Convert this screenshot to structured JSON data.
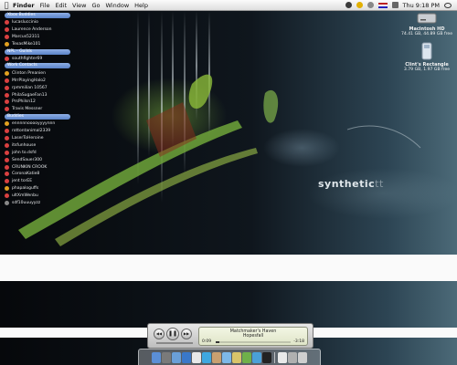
{
  "menubar": {
    "apple": "",
    "items": [
      "Finder",
      "File",
      "Edit",
      "View",
      "Go",
      "Window",
      "Help"
    ],
    "clock": "Thu 9:18 PM"
  },
  "wallpaper": {
    "brand_bold": "synthetic",
    "brand_rest": "tt"
  },
  "desktop_icons": [
    {
      "name": "Macintosh HD",
      "info": "74.41 GB, 44.89 GB free"
    },
    {
      "name": "Clint's Rectangle",
      "info": "3.79 GB, 1.97 GB free"
    }
  ],
  "buddy_list": {
    "groups": [
      {
        "name": "Xbox Buddies",
        "buddies": [
          {
            "name": "lucasluccinio",
            "status": "#d94040"
          },
          {
            "name": "Laurence Anderson",
            "status": "#d94040"
          },
          {
            "name": "Marcus52311",
            "status": "#d94040"
          },
          {
            "name": "TexasMike101",
            "status": "#e0a020"
          }
        ]
      },
      {
        "name": "NPL - Guilds",
        "buddies": [
          {
            "name": "southfighter69",
            "status": "#d94040"
          }
        ]
      },
      {
        "name": "Work Contacts",
        "buddies": [
          {
            "name": "Clinton Preanien",
            "status": "#e0a020"
          },
          {
            "name": "MrrPlayingHalo2",
            "status": "#d94040"
          },
          {
            "name": "rpmmilian 10567",
            "status": "#d94040"
          },
          {
            "name": "PhilaSugaeFan13",
            "status": "#d94040"
          },
          {
            "name": "PrsPhilsn12",
            "status": "#d94040"
          },
          {
            "name": "Travis Messner",
            "status": "#d94040"
          }
        ]
      },
      {
        "name": "Buddies",
        "buddies": [
          {
            "name": "ennnnnooooyyyynnn",
            "status": "#e0a020"
          },
          {
            "name": "rottontanimal2339",
            "status": "#d94040"
          },
          {
            "name": "LaserToHeroine",
            "status": "#d94040"
          },
          {
            "name": "itsfunhouse",
            "status": "#d94040"
          },
          {
            "name": "john to.dsfd",
            "status": "#d94040"
          },
          {
            "name": "SendSauer300",
            "status": "#d94040"
          },
          {
            "name": "CRUNKIN CROOK",
            "status": "#d94040"
          },
          {
            "name": "CoronaKatie8",
            "status": "#d94040"
          },
          {
            "name": "jent torEE",
            "status": "#d94040"
          },
          {
            "name": "phapaloguffs",
            "status": "#e0a020"
          },
          {
            "name": "ultXmWenbu",
            "status": "#d94040"
          },
          {
            "name": "sdf10uuuyyzz",
            "status": "#888888"
          }
        ]
      }
    ]
  },
  "itunes": {
    "prev": "◀◀",
    "play": "❚❚",
    "next": "▶▶",
    "song": "Matchmaker's Haven",
    "artist": "Hopesfall",
    "elapsed": "0:09",
    "remaining": "-3:18",
    "progress": 0.05
  },
  "dock": {
    "icons": [
      {
        "name": "finder",
        "color": "#5b8fd6"
      },
      {
        "name": "system-preferences",
        "color": "#7a7a7a"
      },
      {
        "name": "mail",
        "color": "#6a9fd8"
      },
      {
        "name": "safari",
        "color": "#3a78c9"
      },
      {
        "name": "textedit",
        "color": "#e8e8e8"
      },
      {
        "name": "ichat",
        "color": "#3fa8e0"
      },
      {
        "name": "address-book",
        "color": "#c8a070"
      },
      {
        "name": "itunes",
        "color": "#7db8e8"
      },
      {
        "name": "iphoto",
        "color": "#d9c46a"
      },
      {
        "name": "adium",
        "color": "#6fb04a"
      },
      {
        "name": "network",
        "color": "#4aa0d8"
      },
      {
        "name": "terminal",
        "color": "#222222"
      },
      {
        "name": "app-store",
        "color": "#e9e9e9"
      },
      {
        "name": "photos",
        "color": "#b0b0b0"
      },
      {
        "name": "trash",
        "color": "#cfcfcf"
      }
    ]
  }
}
